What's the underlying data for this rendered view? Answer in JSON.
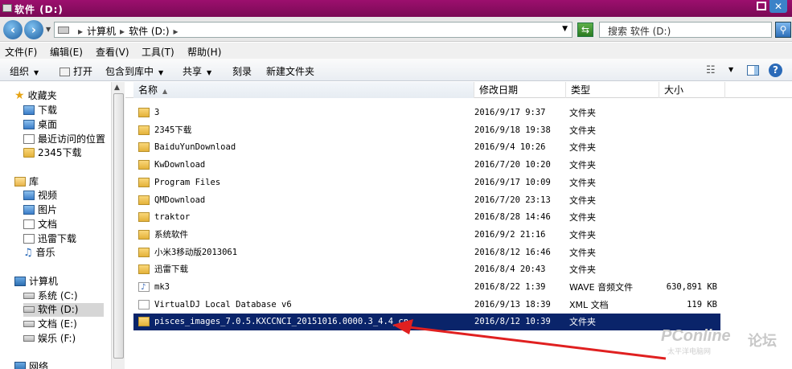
{
  "window": {
    "title": "软件 (D:)"
  },
  "address": {
    "segments": [
      "计算机",
      "软件 (D:)"
    ],
    "search_placeholder": "搜索 软件 (D:)"
  },
  "menu": [
    "文件(F)",
    "编辑(E)",
    "查看(V)",
    "工具(T)",
    "帮助(H)"
  ],
  "toolbar": {
    "organize": "组织",
    "open": "打开",
    "include_in_library": "包含到库中",
    "share": "共享",
    "burn": "刻录",
    "new_folder": "新建文件夹"
  },
  "nav": {
    "favorites": {
      "label": "收藏夹",
      "items": [
        "下载",
        "桌面",
        "最近访问的位置",
        "2345下载"
      ]
    },
    "libraries": {
      "label": "库",
      "items": [
        "视频",
        "图片",
        "文档",
        "迅雷下载",
        "音乐"
      ]
    },
    "computer": {
      "label": "计算机",
      "items": [
        "系统 (C:)",
        "软件 (D:)",
        "文档 (E:)",
        "娱乐 (F:)"
      ]
    },
    "network": {
      "label": "网络"
    }
  },
  "columns": {
    "name": "名称",
    "date": "修改日期",
    "type": "类型",
    "size": "大小"
  },
  "files": [
    {
      "name": "3",
      "date": "2016/9/17 9:37",
      "type": "文件夹",
      "size": "",
      "icon": "folder"
    },
    {
      "name": "2345下载",
      "date": "2016/9/18 19:38",
      "type": "文件夹",
      "size": "",
      "icon": "folder"
    },
    {
      "name": "BaiduYunDownload",
      "date": "2016/9/4 10:26",
      "type": "文件夹",
      "size": "",
      "icon": "folder"
    },
    {
      "name": "KwDownload",
      "date": "2016/7/20 10:20",
      "type": "文件夹",
      "size": "",
      "icon": "folder"
    },
    {
      "name": "Program Files",
      "date": "2016/9/17 10:09",
      "type": "文件夹",
      "size": "",
      "icon": "folder"
    },
    {
      "name": "QMDownload",
      "date": "2016/7/20 23:13",
      "type": "文件夹",
      "size": "",
      "icon": "folder"
    },
    {
      "name": "traktor",
      "date": "2016/8/28 14:46",
      "type": "文件夹",
      "size": "",
      "icon": "folder"
    },
    {
      "name": "系统软件",
      "date": "2016/9/2 21:16",
      "type": "文件夹",
      "size": "",
      "icon": "folder"
    },
    {
      "name": "小米3移动版2013061",
      "date": "2016/8/12 16:46",
      "type": "文件夹",
      "size": "",
      "icon": "folder"
    },
    {
      "name": "迅雷下载",
      "date": "2016/8/4 20:43",
      "type": "文件夹",
      "size": "",
      "icon": "folder"
    },
    {
      "name": "mk3",
      "date": "2016/8/22 1:39",
      "type": "WAVE 音频文件",
      "size": "630,891 KB",
      "icon": "wav"
    },
    {
      "name": "VirtualDJ Local Database v6",
      "date": "2016/9/13 18:39",
      "type": "XML 文档",
      "size": "119 KB",
      "icon": "xml"
    },
    {
      "name": "pisces_images_7.0.5.KXCCNCI_20151016.0000.3_4.4_cn",
      "date": "2016/8/12 10:39",
      "type": "文件夹",
      "size": "",
      "icon": "folder",
      "selected": true
    }
  ],
  "watermark": {
    "brand": "PConline",
    "sub": "太平洋电脑网",
    "forum": "论坛"
  },
  "colors": {
    "title_bar": "#8a0c62",
    "selection": "#0a246a",
    "annotation_arrow": "#e02020"
  }
}
